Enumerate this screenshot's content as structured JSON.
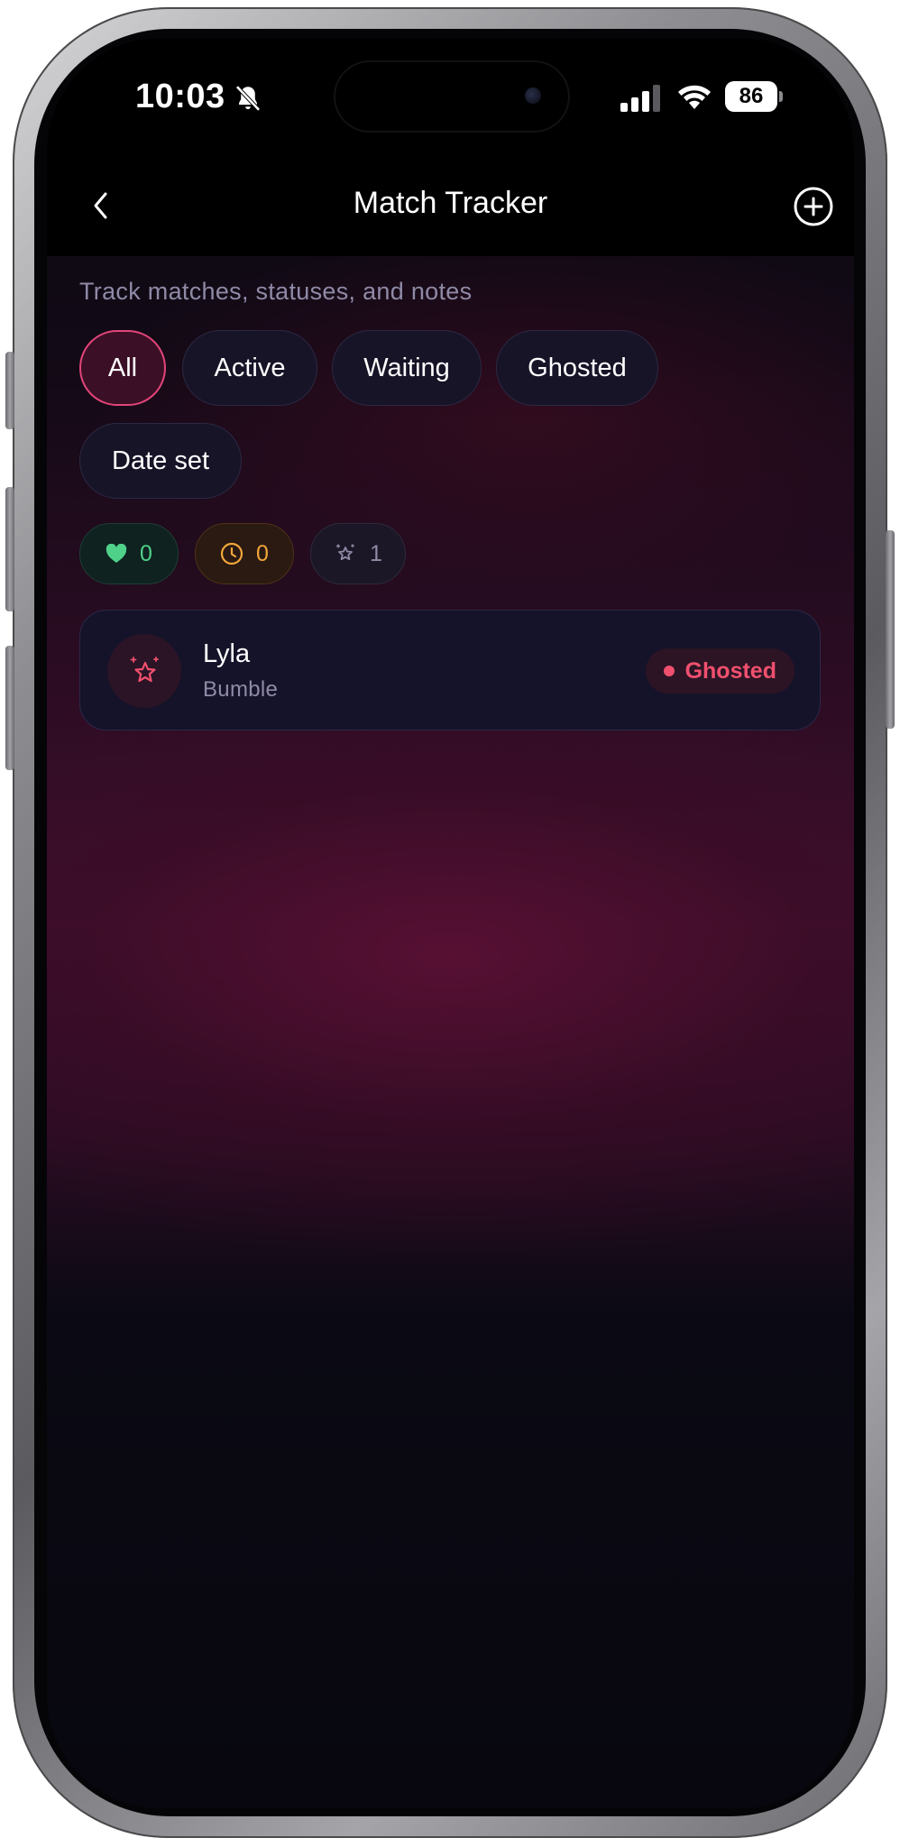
{
  "status_bar": {
    "time": "10:03",
    "battery": "86",
    "icons": [
      "bell-slash-icon",
      "signal-icon",
      "wifi-icon",
      "battery-icon"
    ]
  },
  "header": {
    "title": "Match Tracker",
    "back_icon": "chevron-left-icon",
    "add_icon": "plus-circle-icon"
  },
  "subtitle": "Track matches, statuses, and notes",
  "filters": [
    {
      "label": "All",
      "selected": true
    },
    {
      "label": "Active",
      "selected": false
    },
    {
      "label": "Waiting",
      "selected": false
    },
    {
      "label": "Ghosted",
      "selected": false
    },
    {
      "label": "Date set",
      "selected": false
    }
  ],
  "stats": [
    {
      "icon": "heart-icon",
      "count": "0",
      "color": "#4fd18a"
    },
    {
      "icon": "clock-icon",
      "count": "0",
      "color": "#f2a63a"
    },
    {
      "icon": "ghost-star-icon",
      "count": "1",
      "color": "#8f8aa6"
    }
  ],
  "matches": [
    {
      "name": "Lyla",
      "app": "Bumble",
      "status": "Ghosted",
      "status_color": "#f0506e",
      "avatar_icon": "sparkle-star-icon"
    }
  ],
  "colors": {
    "accent": "#e2457a",
    "background": "#0b0a14",
    "card": "#15132a"
  }
}
